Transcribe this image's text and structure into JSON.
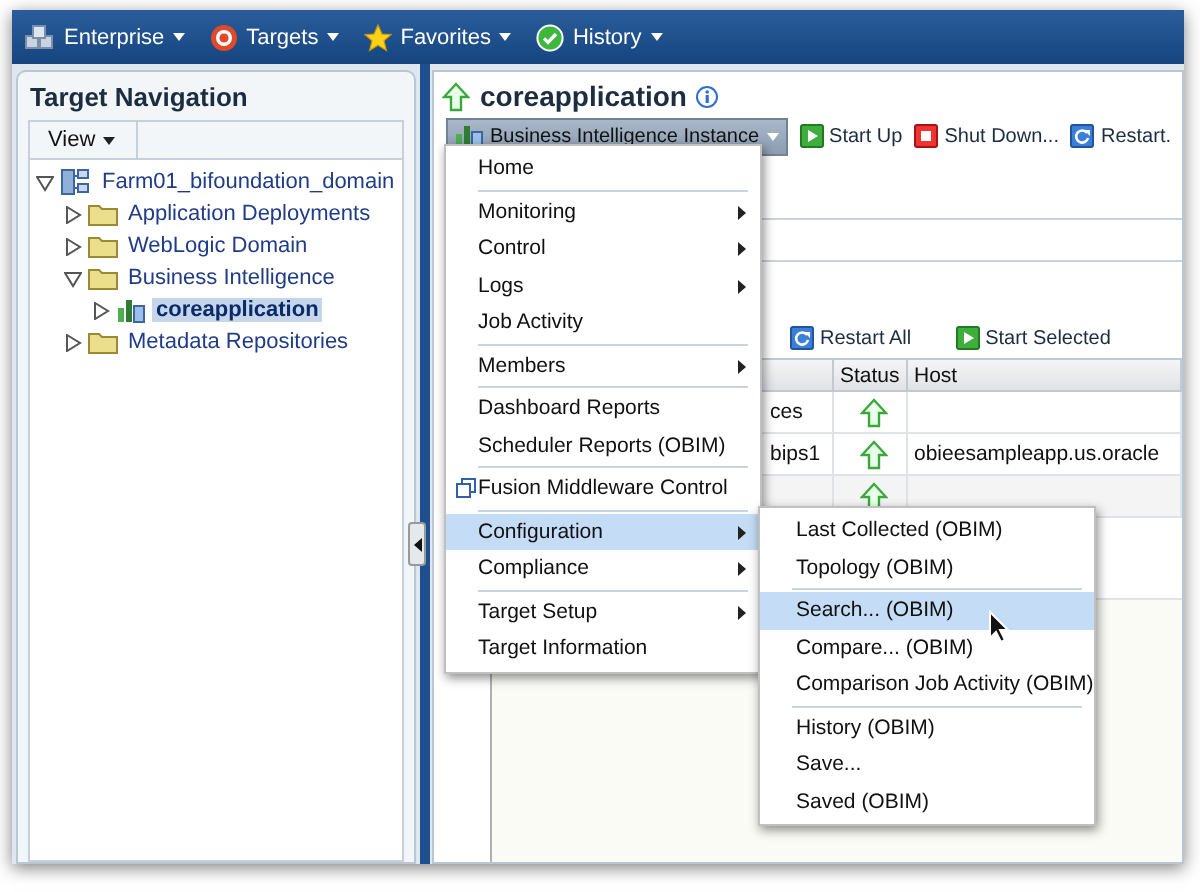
{
  "menubar": [
    {
      "label": "Enterprise",
      "kind": "enterprise"
    },
    {
      "label": "Targets",
      "kind": "targets"
    },
    {
      "label": "Favorites",
      "kind": "favorites"
    },
    {
      "label": "History",
      "kind": "history"
    }
  ],
  "navigation": {
    "title": "Target Navigation",
    "view_button": "View",
    "tree": [
      {
        "label": "Farm01_bifoundation_domain",
        "kind": "farm",
        "expanded": true,
        "selected": false,
        "children": [
          {
            "label": "Application Deployments",
            "kind": "folder",
            "expanded": false,
            "selected": false
          },
          {
            "label": "WebLogic Domain",
            "kind": "folder",
            "expanded": false,
            "selected": false
          },
          {
            "label": "Business Intelligence",
            "kind": "folder",
            "expanded": true,
            "selected": false,
            "children": [
              {
                "label": "coreapplication",
                "kind": "instance",
                "expanded": false,
                "selected": true
              }
            ]
          },
          {
            "label": "Metadata Repositories",
            "kind": "folder",
            "expanded": false,
            "selected": false
          }
        ]
      }
    ]
  },
  "target": {
    "title": "coreapplication",
    "status_up": true,
    "menu_button": "Business Intelligence Instance",
    "actions": [
      {
        "label": "Start Up",
        "kind": "start"
      },
      {
        "label": "Shut Down...",
        "kind": "stop"
      },
      {
        "label": "Restart.",
        "kind": "restart"
      }
    ],
    "table_actions": [
      {
        "label": "Restart All",
        "kind": "restart"
      },
      {
        "label": "Start Selected",
        "kind": "start"
      }
    ],
    "table": {
      "columns": [
        "Status",
        "Host"
      ],
      "rows": [
        {
          "column_1": "ces",
          "status_up": true
        },
        {
          "column_1": "bips1",
          "status_up": true,
          "host": "obieesampleapp.us.oracle"
        },
        {
          "status_up": true
        }
      ]
    }
  },
  "menu": {
    "groups": [
      [
        {
          "label": "Home",
          "submenu": false,
          "selected": false
        }
      ],
      [
        {
          "label": "Monitoring",
          "submenu": true,
          "selected": false
        },
        {
          "label": "Control",
          "submenu": true,
          "selected": false
        },
        {
          "label": "Logs",
          "submenu": true,
          "selected": false
        },
        {
          "label": "Job Activity",
          "submenu": false,
          "selected": false
        }
      ],
      [
        {
          "label": "Members",
          "submenu": true,
          "selected": false
        }
      ],
      [
        {
          "label": "Dashboard Reports",
          "submenu": false,
          "selected": false
        },
        {
          "label": "Scheduler Reports (OBIM)",
          "submenu": false,
          "selected": false
        }
      ],
      [
        {
          "label": "Fusion Middleware Control",
          "submenu": false,
          "selected": false,
          "external": true
        }
      ],
      [
        {
          "label": "Configuration",
          "submenu": true,
          "selected": true
        },
        {
          "label": "Compliance",
          "submenu": true,
          "selected": false
        }
      ],
      [
        {
          "label": "Target Setup",
          "submenu": true,
          "selected": false
        },
        {
          "label": "Target Information",
          "submenu": false,
          "selected": false
        }
      ]
    ]
  },
  "submenu": {
    "groups": [
      [
        {
          "label": "Last Collected (OBIM)",
          "selected": false
        },
        {
          "label": "Topology (OBIM)",
          "selected": false
        }
      ],
      [
        {
          "label": "Search... (OBIM)",
          "selected": true
        },
        {
          "label": "Compare... (OBIM)",
          "selected": false
        },
        {
          "label": "Comparison Job Activity (OBIM)",
          "selected": false
        }
      ],
      [
        {
          "label": "History (OBIM)",
          "selected": false
        },
        {
          "label": "Save...",
          "selected": false
        },
        {
          "label": "Saved (OBIM)",
          "selected": false
        }
      ]
    ]
  }
}
